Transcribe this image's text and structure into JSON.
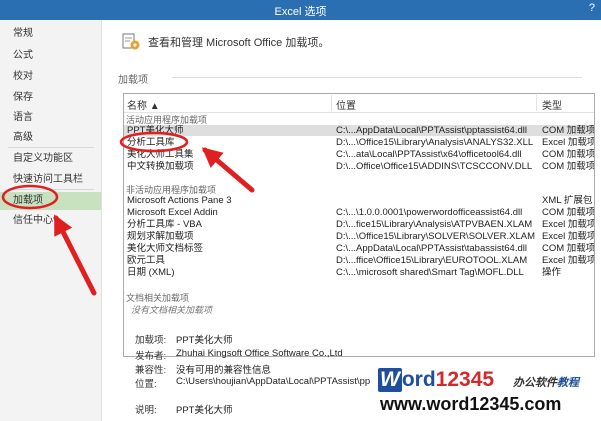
{
  "window": {
    "title": "Excel 选项",
    "help": "?"
  },
  "sidebar": {
    "items": [
      "常规",
      "公式",
      "校对",
      "保存",
      "语言",
      "高级",
      "自定义功能区",
      "快速访问工具栏",
      "加载项",
      "信任中心"
    ],
    "active": "加载项"
  },
  "header": {
    "text": "查看和管理 Microsoft Office 加载项。",
    "icon": "addin-gear-icon"
  },
  "section_label": "加载项",
  "table": {
    "columns": [
      "名称 ▲",
      "位置",
      "类型"
    ],
    "active_group": "活动应用程序加载项",
    "active_rows": [
      {
        "name": "PPT美化大师",
        "location": "C:\\...AppData\\Local\\PPTAssist\\pptassist64.dll",
        "type": "COM 加载项"
      },
      {
        "name": "分析工具库",
        "location": "D:\\...\\Office15\\Library\\Analysis\\ANALYS32.XLL",
        "type": "Excel 加载项"
      },
      {
        "name": "美化大师工具集",
        "location": "C:\\...ata\\Local\\PPTAssist\\x64\\officetool64.dll",
        "type": "COM 加载项"
      },
      {
        "name": "中文转换加载项",
        "location": "D:\\...Office\\Office15\\ADDINS\\TCSCCONV.DLL",
        "type": "COM 加载项"
      }
    ],
    "inactive_group": "非活动应用程序加载项",
    "inactive_rows": [
      {
        "name": "Microsoft Actions Pane 3",
        "location": "",
        "type": "XML 扩展包"
      },
      {
        "name": "Microsoft Excel Addin",
        "location": "C:\\...\\1.0.0.0001\\powerwordofficeassist64.dll",
        "type": "COM 加载项"
      },
      {
        "name": "分析工具库 - VBA",
        "location": "D:\\...fice15\\Library\\Analysis\\ATPVBAEN.XLAM",
        "type": "Excel 加载项"
      },
      {
        "name": "规划求解加载项",
        "location": "D:\\...\\Office15\\Library\\SOLVER\\SOLVER.XLAM",
        "type": "Excel 加载项"
      },
      {
        "name": "美化大师文档标签",
        "location": "C:\\...AppData\\Local\\PPTAssist\\tabassist64.dll",
        "type": "COM 加载项"
      },
      {
        "name": "欧元工具",
        "location": "D:\\...ffice\\Office15\\Library\\EUROTOOL.XLAM",
        "type": "Excel 加载项"
      },
      {
        "name": "日期 (XML)",
        "location": "C:\\...\\microsoft shared\\Smart Tag\\MOFL.DLL",
        "type": "操作"
      }
    ],
    "doc_group": "文档相关加载项",
    "doc_empty": "没有文档相关加载项"
  },
  "details": {
    "addin_label": "加载项:",
    "addin_value": "PPT美化大师",
    "publisher_label": "发布者:",
    "publisher_value": "Zhuhai Kingsoft Office Software Co.,Ltd",
    "compat_label": "兼容性:",
    "compat_value": "没有可用的兼容性信息",
    "location_label": "位置:",
    "location_value": "C:\\Users\\houjian\\AppData\\Local\\PPTAssist\\pp",
    "desc_label": "说明:",
    "desc_value": "PPT美化大师"
  },
  "watermark": {
    "w": "W",
    "brand": "ord",
    "numbers": "12345",
    "tag1": "办公软件",
    "tag2": "教程",
    "url": "www.word12345.com"
  },
  "colors": {
    "titlebar": "#2b6fb3",
    "active_nav": "#c8e2c0",
    "annotation": "#e02020",
    "brand_blue": "#1f4e9c"
  }
}
